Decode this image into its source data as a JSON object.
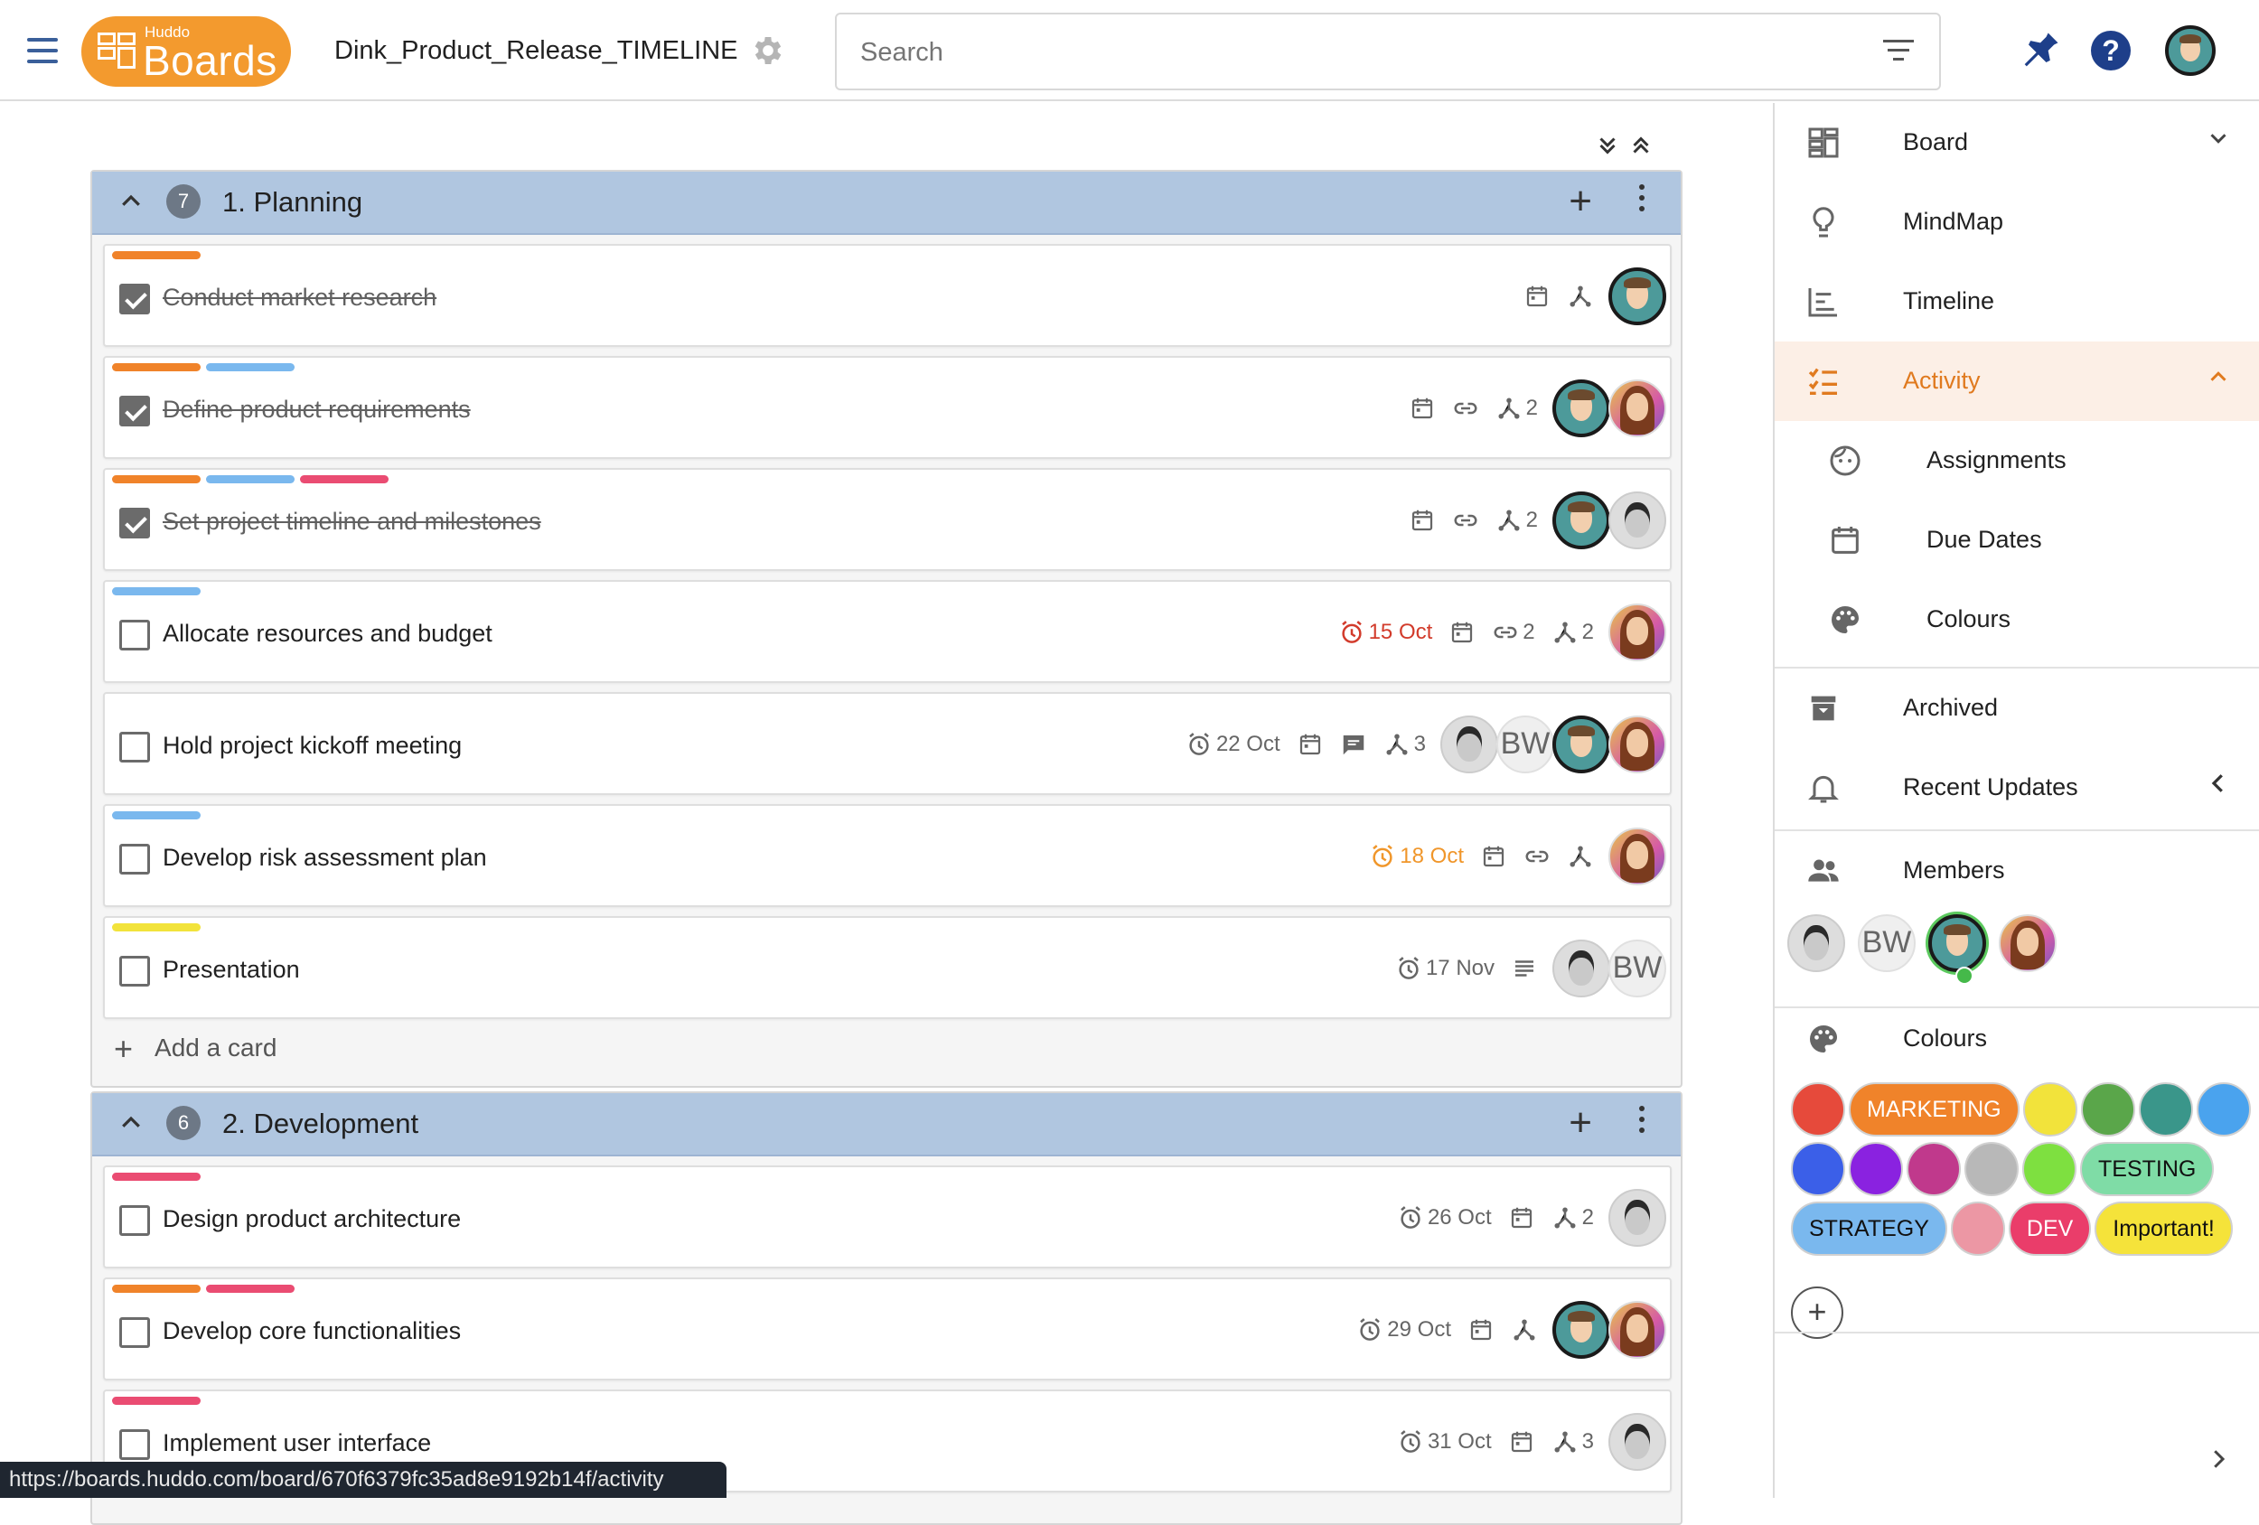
{
  "header": {
    "logo_small": "Huddo",
    "logo_big": "Boards",
    "board_title": "Dink_Product_Release_TIMELINE",
    "search_placeholder": "Search"
  },
  "colors": {
    "orange": "#f0832a",
    "blue": "#7ab8ee",
    "pink": "#ea4c72",
    "yellow": "#f2e33b",
    "lane_header": "#b0c6e0",
    "accent": "#e07a1f"
  },
  "lanes": [
    {
      "count": "7",
      "title": "1. Planning",
      "add_card": "Add a card",
      "cards": [
        {
          "title": "Conduct market research",
          "done": true,
          "labels": [
            "orange"
          ],
          "date": "",
          "icons": [
            "calendar-icon",
            "subtasks-icon"
          ],
          "subtasks": "",
          "links": "",
          "avatars": [
            "man"
          ]
        },
        {
          "title": "Define product requirements",
          "done": true,
          "labels": [
            "orange",
            "blue"
          ],
          "date": "",
          "icons": [
            "calendar-icon",
            "link-icon",
            "subtasks-icon"
          ],
          "subtasks": "2",
          "links": "",
          "avatars": [
            "man",
            "woman"
          ]
        },
        {
          "title": "Set project timeline and milestones",
          "done": true,
          "labels": [
            "orange",
            "blue",
            "pink"
          ],
          "date": "",
          "icons": [
            "calendar-icon",
            "link-icon",
            "subtasks-icon"
          ],
          "subtasks": "2",
          "links": "",
          "avatars": [
            "man",
            "photo"
          ]
        },
        {
          "title": "Allocate resources and budget",
          "done": false,
          "labels": [
            "blue"
          ],
          "date": "15 Oct",
          "date_status": "red",
          "icons": [
            "calendar-icon",
            "link-icon",
            "subtasks-icon"
          ],
          "subtasks": "2",
          "links": "2",
          "avatars": [
            "woman"
          ]
        },
        {
          "title": "Hold project kickoff meeting",
          "done": false,
          "labels": [],
          "date": "22 Oct",
          "date_status": "normal",
          "icons": [
            "calendar-icon",
            "comment-icon",
            "subtasks-icon"
          ],
          "subtasks": "3",
          "links": "",
          "avatars": [
            "photo",
            "bw",
            "man",
            "woman"
          ]
        },
        {
          "title": "Develop risk assessment plan",
          "done": false,
          "labels": [
            "blue"
          ],
          "date": "18 Oct",
          "date_status": "orange",
          "icons": [
            "calendar-icon",
            "link-icon",
            "subtasks-icon"
          ],
          "subtasks": "",
          "links": "",
          "avatars": [
            "woman"
          ]
        },
        {
          "title": "Presentation",
          "done": false,
          "labels": [
            "yellow"
          ],
          "date": "17 Nov",
          "date_status": "normal",
          "icons": [
            "description-icon"
          ],
          "subtasks": "",
          "links": "",
          "avatars": [
            "photo",
            "bw"
          ]
        }
      ]
    },
    {
      "count": "6",
      "title": "2. Development",
      "cards": [
        {
          "title": "Design product architecture",
          "done": false,
          "labels": [
            "pink"
          ],
          "date": "26 Oct",
          "date_status": "normal",
          "icons": [
            "calendar-icon",
            "subtasks-icon"
          ],
          "subtasks": "2",
          "links": "",
          "avatars": [
            "photo"
          ]
        },
        {
          "title": "Develop core functionalities",
          "done": false,
          "labels": [
            "orange",
            "pink"
          ],
          "date": "29 Oct",
          "date_status": "normal",
          "icons": [
            "calendar-icon",
            "subtasks-icon"
          ],
          "subtasks": "",
          "links": "",
          "avatars": [
            "man",
            "woman"
          ]
        },
        {
          "title": "Implement user interface",
          "done": false,
          "labels": [
            "pink"
          ],
          "date": "31 Oct",
          "date_status": "normal",
          "icons": [
            "calendar-icon",
            "subtasks-icon"
          ],
          "subtasks": "3",
          "links": "",
          "avatars": [
            "photo"
          ]
        }
      ]
    }
  ],
  "sidebar": {
    "board": "Board",
    "mindmap": "MindMap",
    "timeline": "Timeline",
    "activity": "Activity",
    "assignments": "Assignments",
    "due_dates": "Due Dates",
    "colours_sub": "Colours",
    "archived": "Archived",
    "recent_updates": "Recent Updates",
    "members": "Members",
    "colours": "Colours",
    "member_bw": "BW",
    "colour_chips": [
      [
        {
          "color": "#e64a3b"
        },
        {
          "color": "#f0832a",
          "label": "MARKETING"
        },
        {
          "color": "#f2e33b"
        },
        {
          "color": "#5aa64a"
        },
        {
          "color": "#3a968a"
        },
        {
          "color": "#4aa3ee"
        }
      ],
      [
        {
          "color": "#3b5fe8"
        },
        {
          "color": "#8a22e0"
        },
        {
          "color": "#c0398c"
        },
        {
          "color": "#b8b8b8"
        },
        {
          "color": "#7ee040"
        },
        {
          "color": "#7fdca6",
          "label": "TESTING"
        }
      ],
      [
        {
          "color": "#7ab8ee",
          "label": "STRATEGY"
        },
        {
          "color": "#ec97a4"
        },
        {
          "color": "#ea3d6a",
          "label": "DEV"
        },
        {
          "color": "#f5e33a",
          "label": "Important!"
        }
      ]
    ]
  },
  "statusbar": "https://boards.huddo.com/board/670f6379fc35ad8e9192b14f/activity"
}
